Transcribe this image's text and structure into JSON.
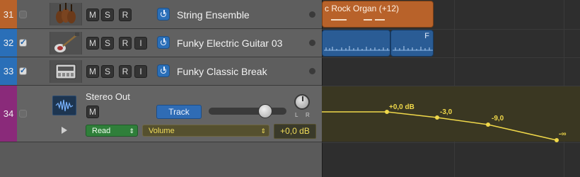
{
  "tracks": [
    {
      "number": "31",
      "name": "String Ensemble",
      "buttons": [
        "M",
        "S",
        "R"
      ],
      "checked": false,
      "color": "#b8622a",
      "instrument_icon": "violin-icon"
    },
    {
      "number": "32",
      "name": "Funky Electric Guitar 03",
      "buttons": [
        "M",
        "S",
        "R",
        "I"
      ],
      "checked": true,
      "color": "#2a6fb8",
      "instrument_icon": "electric-guitar-icon"
    },
    {
      "number": "33",
      "name": "Funky Classic Break",
      "buttons": [
        "M",
        "S",
        "R",
        "I"
      ],
      "checked": true,
      "color": "#2a6fb8",
      "instrument_icon": "drum-machine-icon"
    }
  ],
  "stereo_out": {
    "number": "34",
    "name": "Stereo Out",
    "mute_label": "M",
    "track_button": "Track",
    "automation_mode": "Read",
    "automation_param": "Volume",
    "value": "+0,0 dB",
    "color": "#8a2a7a",
    "volume_level": 0.8,
    "pan_labels": {
      "l": "L",
      "r": "R"
    }
  },
  "regions": {
    "organ_label": "c Rock Organ (+12)",
    "organ_color": "#b8622a",
    "guitar_color": "#2a5c95",
    "guitar_second_label": "F"
  },
  "automation_points": [
    {
      "label": "+0,0 dB"
    },
    {
      "label": "-3,0"
    },
    {
      "label": "-9,0"
    },
    {
      "label": "-∞"
    }
  ],
  "colors": {
    "automation_line": "#f0d84a"
  }
}
